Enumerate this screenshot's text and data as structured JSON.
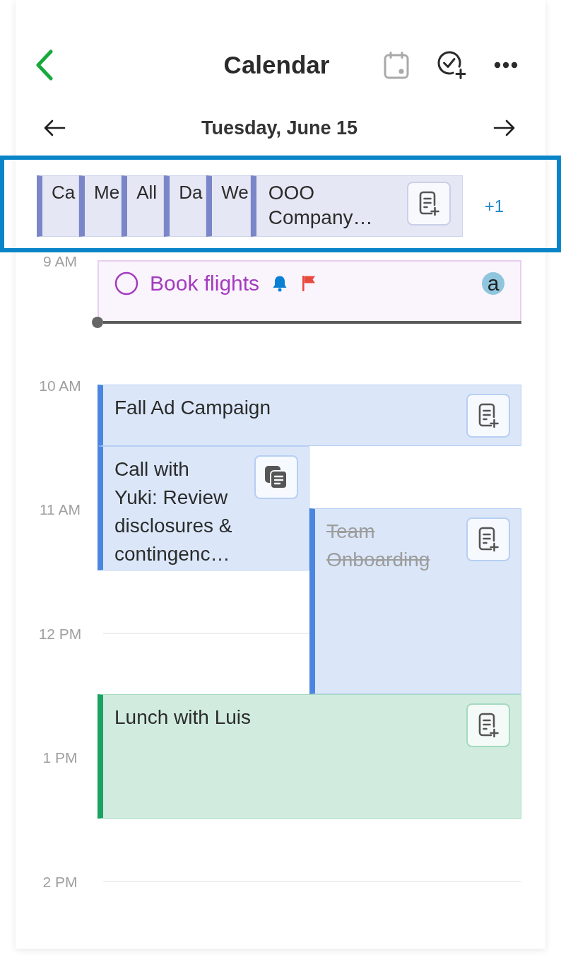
{
  "header": {
    "title": "Calendar",
    "actions": [
      {
        "kind": "today",
        "disabled": true
      },
      {
        "kind": "add_task",
        "disabled": false
      },
      {
        "kind": "more",
        "disabled": false
      }
    ]
  },
  "date_nav": {
    "date": "Tuesday, June 15"
  },
  "all_day": {
    "highlighted": true,
    "events": [
      {
        "title": "Ca",
        "color": "#7b86c8",
        "collapsed": true
      },
      {
        "title": "Me",
        "color": "#7b86c8",
        "collapsed": true
      },
      {
        "title": "All",
        "color": "#7b86c8",
        "collapsed": true
      },
      {
        "title": "Da",
        "color": "#7b86c8",
        "collapsed": true
      },
      {
        "title": "We",
        "color": "#7b86c8",
        "collapsed": true
      },
      {
        "title": "OOO Company…",
        "color": "#7b86c8",
        "collapsed": false,
        "has_notes": false
      }
    ],
    "more_label": "+1"
  },
  "timeline": {
    "hours": [
      "9 AM",
      "10 AM",
      "11 AM",
      "12 PM",
      "1 PM",
      "2 PM"
    ],
    "tasks": [
      {
        "title": "Book flights",
        "color": "#a33bbf",
        "completed": false,
        "reminder": true,
        "flagged": true,
        "assignee": "a"
      }
    ],
    "events": [
      {
        "title": "Fall Ad Campaign",
        "color": "#4a86e0",
        "cancelled": false,
        "has_notes": false
      },
      {
        "title": "Call with Yuki: Review disclosures & contingenc…",
        "color": "#4a86e0",
        "cancelled": false,
        "has_notes": true
      },
      {
        "title": "Team Onboarding",
        "color": "#4a86e0",
        "cancelled": true,
        "has_notes": false
      },
      {
        "title": "Lunch with Luis",
        "color": "#1aa260",
        "cancelled": false,
        "has_notes": false
      }
    ]
  }
}
